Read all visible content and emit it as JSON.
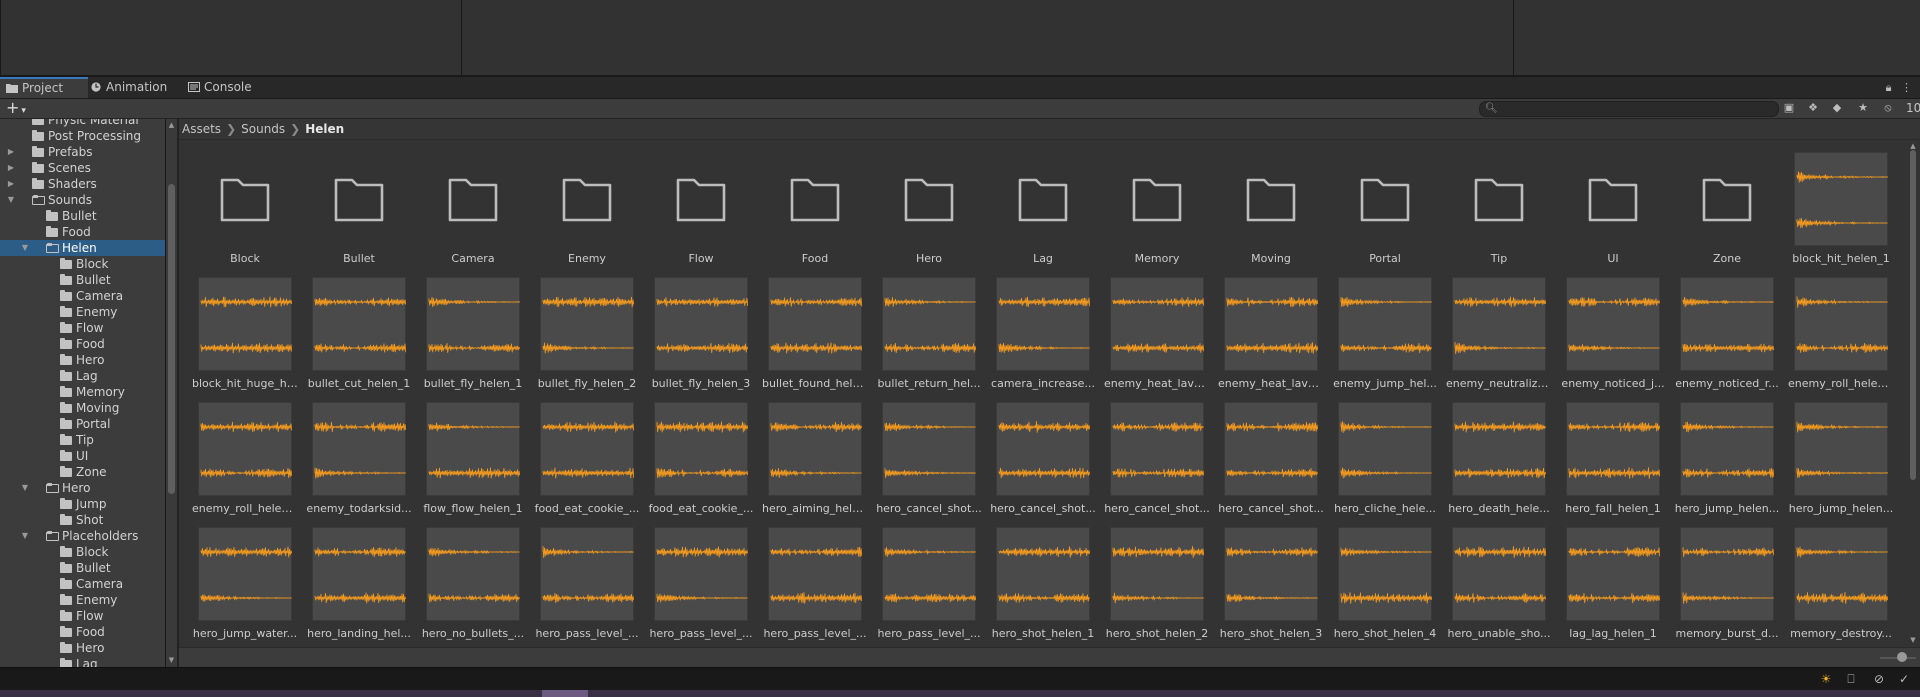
{
  "tabs": [
    {
      "label": "Project",
      "icon": "folder-icon",
      "active": true
    },
    {
      "label": "Animation",
      "icon": "clock-icon",
      "active": false
    },
    {
      "label": "Console",
      "icon": "console-icon",
      "active": false
    }
  ],
  "toolbar": {
    "add_label": "+",
    "search_placeholder": "",
    "hidden_count": "10"
  },
  "breadcrumb": [
    "Assets",
    "Sounds",
    "Helen"
  ],
  "tree": [
    {
      "label": "Physic Material",
      "depth": 0,
      "arrow": "",
      "open": false
    },
    {
      "label": "Post Processing",
      "depth": 0,
      "arrow": "",
      "open": false
    },
    {
      "label": "Prefabs",
      "depth": 0,
      "arrow": "right",
      "open": false
    },
    {
      "label": "Scenes",
      "depth": 0,
      "arrow": "right",
      "open": false
    },
    {
      "label": "Shaders",
      "depth": 0,
      "arrow": "right",
      "open": false
    },
    {
      "label": "Sounds",
      "depth": 0,
      "arrow": "down",
      "open": true
    },
    {
      "label": "Bullet",
      "depth": 1,
      "arrow": "",
      "open": false
    },
    {
      "label": "Food",
      "depth": 1,
      "arrow": "",
      "open": false
    },
    {
      "label": "Helen",
      "depth": 1,
      "arrow": "down",
      "open": true,
      "selected": true
    },
    {
      "label": "Block",
      "depth": 2,
      "arrow": "",
      "open": false
    },
    {
      "label": "Bullet",
      "depth": 2,
      "arrow": "",
      "open": false
    },
    {
      "label": "Camera",
      "depth": 2,
      "arrow": "",
      "open": false
    },
    {
      "label": "Enemy",
      "depth": 2,
      "arrow": "",
      "open": false
    },
    {
      "label": "Flow",
      "depth": 2,
      "arrow": "",
      "open": false
    },
    {
      "label": "Food",
      "depth": 2,
      "arrow": "",
      "open": false
    },
    {
      "label": "Hero",
      "depth": 2,
      "arrow": "",
      "open": false
    },
    {
      "label": "Lag",
      "depth": 2,
      "arrow": "",
      "open": false
    },
    {
      "label": "Memory",
      "depth": 2,
      "arrow": "",
      "open": false
    },
    {
      "label": "Moving",
      "depth": 2,
      "arrow": "",
      "open": false
    },
    {
      "label": "Portal",
      "depth": 2,
      "arrow": "",
      "open": false
    },
    {
      "label": "Tip",
      "depth": 2,
      "arrow": "",
      "open": false
    },
    {
      "label": "UI",
      "depth": 2,
      "arrow": "",
      "open": false
    },
    {
      "label": "Zone",
      "depth": 2,
      "arrow": "",
      "open": false
    },
    {
      "label": "Hero",
      "depth": 1,
      "arrow": "down",
      "open": true
    },
    {
      "label": "Jump",
      "depth": 2,
      "arrow": "",
      "open": false
    },
    {
      "label": "Shot",
      "depth": 2,
      "arrow": "",
      "open": false
    },
    {
      "label": "Placeholders",
      "depth": 1,
      "arrow": "down",
      "open": true
    },
    {
      "label": "Block",
      "depth": 2,
      "arrow": "",
      "open": false
    },
    {
      "label": "Bullet",
      "depth": 2,
      "arrow": "",
      "open": false
    },
    {
      "label": "Camera",
      "depth": 2,
      "arrow": "",
      "open": false
    },
    {
      "label": "Enemy",
      "depth": 2,
      "arrow": "",
      "open": false
    },
    {
      "label": "Flow",
      "depth": 2,
      "arrow": "",
      "open": false
    },
    {
      "label": "Food",
      "depth": 2,
      "arrow": "",
      "open": false
    },
    {
      "label": "Hero",
      "depth": 2,
      "arrow": "",
      "open": false
    },
    {
      "label": "Lag",
      "depth": 2,
      "arrow": "",
      "open": false
    }
  ],
  "assets": [
    {
      "name": "Block",
      "type": "folder"
    },
    {
      "name": "Bullet",
      "type": "folder"
    },
    {
      "name": "Camera",
      "type": "folder"
    },
    {
      "name": "Enemy",
      "type": "folder"
    },
    {
      "name": "Flow",
      "type": "folder"
    },
    {
      "name": "Food",
      "type": "folder"
    },
    {
      "name": "Hero",
      "type": "folder"
    },
    {
      "name": "Lag",
      "type": "folder"
    },
    {
      "name": "Memory",
      "type": "folder"
    },
    {
      "name": "Moving",
      "type": "folder"
    },
    {
      "name": "Portal",
      "type": "folder"
    },
    {
      "name": "Tip",
      "type": "folder"
    },
    {
      "name": "UI",
      "type": "folder"
    },
    {
      "name": "Zone",
      "type": "folder"
    },
    {
      "name": "block_hit_helen_1",
      "type": "audio"
    },
    {
      "name": "block_hit_huge_he...",
      "type": "audio"
    },
    {
      "name": "bullet_cut_helen_1",
      "type": "audio"
    },
    {
      "name": "bullet_fly_helen_1",
      "type": "audio"
    },
    {
      "name": "bullet_fly_helen_2",
      "type": "audio"
    },
    {
      "name": "bullet_fly_helen_3",
      "type": "audio"
    },
    {
      "name": "bullet_found_hele...",
      "type": "audio"
    },
    {
      "name": "bullet_return_hel...",
      "type": "audio"
    },
    {
      "name": "camera_increase...",
      "type": "audio"
    },
    {
      "name": "enemy_heat_lava...",
      "type": "audio"
    },
    {
      "name": "enemy_heat_lava...",
      "type": "audio"
    },
    {
      "name": "enemy_jump_hel...",
      "type": "audio"
    },
    {
      "name": "enemy_neutralize...",
      "type": "audio"
    },
    {
      "name": "enemy_noticed_j...",
      "type": "audio"
    },
    {
      "name": "enemy_noticed_r...",
      "type": "audio"
    },
    {
      "name": "enemy_roll_helen...",
      "type": "audio"
    },
    {
      "name": "enemy_roll_helen...",
      "type": "audio"
    },
    {
      "name": "enemy_todarksid...",
      "type": "audio"
    },
    {
      "name": "flow_flow_helen_1",
      "type": "audio"
    },
    {
      "name": "food_eat_cookie_...",
      "type": "audio"
    },
    {
      "name": "food_eat_cookie_...",
      "type": "audio"
    },
    {
      "name": "hero_aiming_hele...",
      "type": "audio"
    },
    {
      "name": "hero_cancel_shot...",
      "type": "audio"
    },
    {
      "name": "hero_cancel_shot...",
      "type": "audio"
    },
    {
      "name": "hero_cancel_shot...",
      "type": "audio"
    },
    {
      "name": "hero_cancel_shot...",
      "type": "audio"
    },
    {
      "name": "hero_cliche_hele...",
      "type": "audio"
    },
    {
      "name": "hero_death_hele...",
      "type": "audio"
    },
    {
      "name": "hero_fall_helen_1",
      "type": "audio"
    },
    {
      "name": "hero_jump_helen...",
      "type": "audio"
    },
    {
      "name": "hero_jump_helen...",
      "type": "audio"
    },
    {
      "name": "hero_jump_water...",
      "type": "audio"
    },
    {
      "name": "hero_landing_hel...",
      "type": "audio"
    },
    {
      "name": "hero_no_bullets_...",
      "type": "audio"
    },
    {
      "name": "hero_pass_level_...",
      "type": "audio"
    },
    {
      "name": "hero_pass_level_...",
      "type": "audio"
    },
    {
      "name": "hero_pass_level_...",
      "type": "audio"
    },
    {
      "name": "hero_pass_level_...",
      "type": "audio"
    },
    {
      "name": "hero_shot_helen_1",
      "type": "audio"
    },
    {
      "name": "hero_shot_helen_2",
      "type": "audio"
    },
    {
      "name": "hero_shot_helen_3",
      "type": "audio"
    },
    {
      "name": "hero_shot_helen_4",
      "type": "audio"
    },
    {
      "name": "hero_unable_sho...",
      "type": "audio"
    },
    {
      "name": "lag_lag_helen_1",
      "type": "audio"
    },
    {
      "name": "memory_burst_d...",
      "type": "audio"
    },
    {
      "name": "memory_destroy...",
      "type": "audio"
    }
  ],
  "colors": {
    "accent": "#3a79bb",
    "selection": "#2c5d87",
    "waveform": "#f39a1e"
  }
}
